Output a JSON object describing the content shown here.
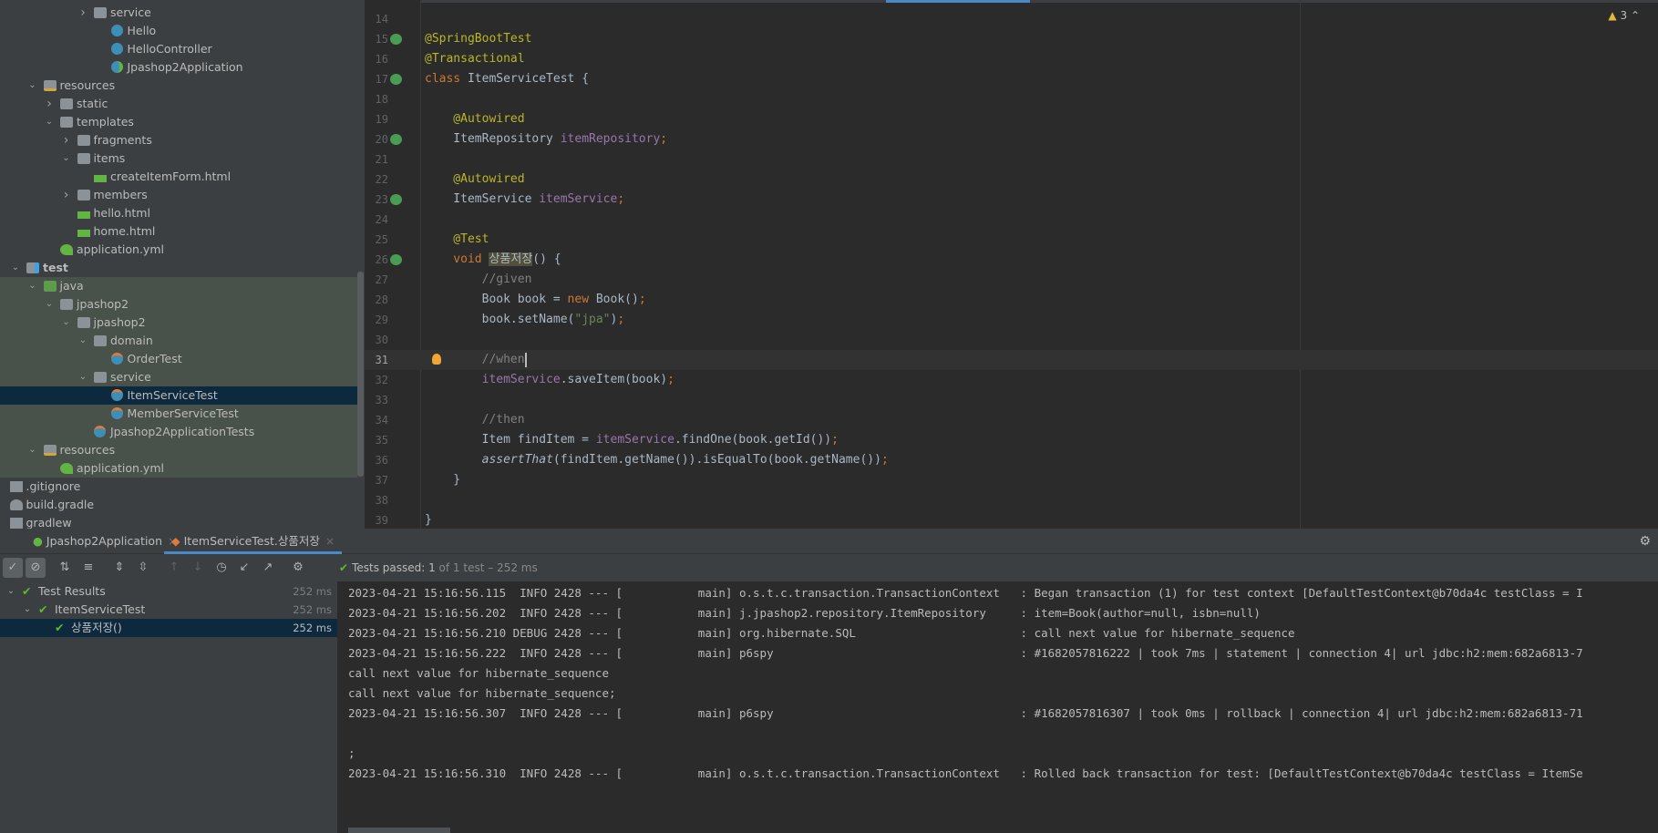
{
  "project_tree": [
    {
      "label": "service",
      "depth": 4,
      "arrow": "collapsed",
      "icon": "package"
    },
    {
      "label": "Hello",
      "depth": 5,
      "icon": "class"
    },
    {
      "label": "HelloController",
      "depth": 5,
      "icon": "class"
    },
    {
      "label": "Jpashop2Application",
      "depth": 5,
      "icon": "spring-class"
    },
    {
      "label": "resources",
      "depth": 1,
      "arrow": "expanded",
      "icon": "resources-folder"
    },
    {
      "label": "static",
      "depth": 2,
      "arrow": "collapsed",
      "icon": "folder"
    },
    {
      "label": "templates",
      "depth": 2,
      "arrow": "expanded",
      "icon": "folder"
    },
    {
      "label": "fragments",
      "depth": 3,
      "arrow": "collapsed",
      "icon": "folder"
    },
    {
      "label": "items",
      "depth": 3,
      "arrow": "expanded",
      "icon": "folder"
    },
    {
      "label": "createItemForm.html",
      "depth": 4,
      "icon": "html-file"
    },
    {
      "label": "members",
      "depth": 3,
      "arrow": "collapsed",
      "icon": "folder"
    },
    {
      "label": "hello.html",
      "depth": 3,
      "icon": "html-file"
    },
    {
      "label": "home.html",
      "depth": 3,
      "icon": "html-file"
    },
    {
      "label": "application.yml",
      "depth": 2,
      "icon": "yml-file"
    },
    {
      "label": "test",
      "depth": 0,
      "arrow": "expanded",
      "icon": "test-folder",
      "bold": true
    },
    {
      "label": "java",
      "depth": 1,
      "arrow": "expanded",
      "icon": "java-folder",
      "green": true
    },
    {
      "label": "jpashop2",
      "depth": 2,
      "arrow": "expanded",
      "icon": "package",
      "green": true
    },
    {
      "label": "jpashop2",
      "depth": 3,
      "arrow": "expanded",
      "icon": "package",
      "green": true
    },
    {
      "label": "domain",
      "depth": 4,
      "arrow": "expanded",
      "icon": "package",
      "green": true
    },
    {
      "label": "OrderTest",
      "depth": 5,
      "icon": "test-class",
      "green": true
    },
    {
      "label": "service",
      "depth": 4,
      "arrow": "expanded",
      "icon": "package",
      "green": true
    },
    {
      "label": "ItemServiceTest",
      "depth": 5,
      "icon": "test-class",
      "selected": true
    },
    {
      "label": "MemberServiceTest",
      "depth": 5,
      "icon": "test-class",
      "green": true
    },
    {
      "label": "Jpashop2ApplicationTests",
      "depth": 4,
      "icon": "test-class",
      "green": true
    },
    {
      "label": "resources",
      "depth": 1,
      "arrow": "expanded",
      "icon": "test-resources-folder",
      "green": true
    },
    {
      "label": "application.yml",
      "depth": 2,
      "icon": "yml-file",
      "green": true
    },
    {
      "label": ".gitignore",
      "depth": -1,
      "icon": "gitignore-file"
    },
    {
      "label": "build.gradle",
      "depth": -1,
      "icon": "gradle-file"
    },
    {
      "label": "gradlew",
      "depth": -1,
      "icon": "script-file"
    }
  ],
  "editor": {
    "warnings_count": "3",
    "current_line": 31,
    "lines": [
      {
        "n": "14",
        "tokens": []
      },
      {
        "n": "15",
        "gutter": "spring-icon",
        "tokens": [
          [
            "@SpringBootTest",
            "ann"
          ]
        ]
      },
      {
        "n": "16",
        "tokens": [
          [
            "@Transactional",
            "ann"
          ]
        ]
      },
      {
        "n": "17",
        "gutter": "run-icon",
        "tokens": [
          [
            "class ",
            "kw"
          ],
          [
            "ItemServiceTest {",
            "txt"
          ]
        ]
      },
      {
        "n": "18",
        "tokens": []
      },
      {
        "n": "19",
        "tokens": [
          [
            "    @Autowired",
            "ann"
          ]
        ]
      },
      {
        "n": "20",
        "gutter": "bean-icon",
        "tokens": [
          [
            "    ItemRepository ",
            "txt"
          ],
          [
            "itemRepository",
            "fld"
          ],
          [
            ";",
            "kw"
          ]
        ]
      },
      {
        "n": "21",
        "tokens": []
      },
      {
        "n": "22",
        "tokens": [
          [
            "    @Autowired",
            "ann"
          ]
        ]
      },
      {
        "n": "23",
        "gutter": "bean-icon",
        "tokens": [
          [
            "    ItemService ",
            "txt"
          ],
          [
            "itemService",
            "fld"
          ],
          [
            ";",
            "kw"
          ]
        ]
      },
      {
        "n": "24",
        "tokens": []
      },
      {
        "n": "25",
        "tokens": [
          [
            "    @Test",
            "ann"
          ]
        ]
      },
      {
        "n": "26",
        "gutter": "run-icon",
        "tokens": [
          [
            "    void ",
            "kw"
          ],
          [
            "상품저장",
            "hl"
          ],
          [
            "() {",
            "txt"
          ]
        ]
      },
      {
        "n": "27",
        "tokens": [
          [
            "        //given",
            "cmt"
          ]
        ]
      },
      {
        "n": "28",
        "tokens": [
          [
            "        Book book = ",
            "txt"
          ],
          [
            "new ",
            "kw"
          ],
          [
            "Book()",
            "txt"
          ],
          [
            ";",
            "kw"
          ]
        ]
      },
      {
        "n": "29",
        "tokens": [
          [
            "        book.setName(",
            "txt"
          ],
          [
            "\"jpa\"",
            "str"
          ],
          [
            ")",
            "txt"
          ],
          [
            ";",
            "kw"
          ]
        ]
      },
      {
        "n": "30",
        "tokens": []
      },
      {
        "n": "31",
        "gutter": "bulb-icon",
        "tokens": [
          [
            "        //when",
            "cmt"
          ]
        ]
      },
      {
        "n": "32",
        "tokens": [
          [
            "        ",
            "txt"
          ],
          [
            "itemService",
            "fld"
          ],
          [
            ".saveItem(book)",
            "txt"
          ],
          [
            ";",
            "kw"
          ]
        ]
      },
      {
        "n": "33",
        "tokens": []
      },
      {
        "n": "34",
        "tokens": [
          [
            "        //then",
            "cmt"
          ]
        ]
      },
      {
        "n": "35",
        "tokens": [
          [
            "        Item findItem = ",
            "txt"
          ],
          [
            "itemService",
            "fld"
          ],
          [
            ".findOne(book.getId())",
            "txt"
          ],
          [
            ";",
            "kw"
          ]
        ]
      },
      {
        "n": "36",
        "tokens": [
          [
            "        ",
            "txt"
          ],
          [
            "assertThat",
            "it"
          ],
          [
            "(findItem.getName()).isEqualTo(book.getName())",
            "txt"
          ],
          [
            ";",
            "kw"
          ]
        ]
      },
      {
        "n": "37",
        "tokens": [
          [
            "    }",
            "txt"
          ]
        ]
      },
      {
        "n": "38",
        "tokens": []
      },
      {
        "n": "39",
        "tokens": [
          [
            "}",
            "txt"
          ]
        ]
      }
    ]
  },
  "run_panel": {
    "tabs": [
      {
        "label": "Jpashop2Application",
        "active": false
      },
      {
        "label": "ItemServiceTest.상품저장",
        "active": true
      }
    ],
    "status": {
      "prefix": "Tests passed: ",
      "count": "1",
      "rest": " of 1 test – 252 ms"
    },
    "test_tree": [
      {
        "label": "Test Results",
        "time": "252 ms",
        "depth": 0,
        "arrow": true
      },
      {
        "label": "ItemServiceTest",
        "time": "252 ms",
        "depth": 1,
        "arrow": true
      },
      {
        "label": "상품저장()",
        "time": "252 ms",
        "depth": 2,
        "selected": true
      }
    ],
    "log": [
      "2023-04-21 15:16:56.115  INFO 2428 --- [           main] o.s.t.c.transaction.TransactionContext   : Began transaction (1) for test context [DefaultTestContext@b70da4c testClass = I",
      "2023-04-21 15:16:56.202  INFO 2428 --- [           main] j.jpashop2.repository.ItemRepository     : item=Book(author=null, isbn=null)",
      "2023-04-21 15:16:56.210 DEBUG 2428 --- [           main] org.hibernate.SQL                        : call next value for hibernate_sequence",
      "2023-04-21 15:16:56.222  INFO 2428 --- [           main] p6spy                                    : #1682057816222 | took 7ms | statement | connection 4| url jdbc:h2:mem:682a6813-7",
      "call next value for hibernate_sequence",
      "call next value for hibernate_sequence;",
      "2023-04-21 15:16:56.307  INFO 2428 --- [           main] p6spy                                    : #1682057816307 | took 0ms | rollback | connection 4| url jdbc:h2:mem:682a6813-71",
      "",
      ";",
      "2023-04-21 15:16:56.310  INFO 2428 --- [           main] o.s.t.c.transaction.TransactionContext   : Rolled back transaction for test: [DefaultTestContext@b70da4c testClass = ItemSe"
    ]
  },
  "colors": {
    "accent": "#4a88c7",
    "pass": "#5fb832",
    "selection": "#0d293e"
  }
}
